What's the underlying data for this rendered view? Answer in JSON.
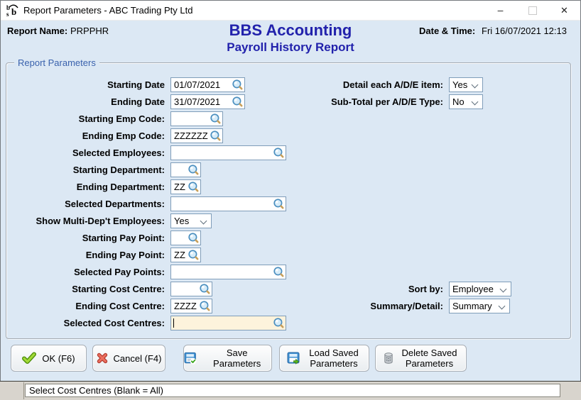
{
  "titlebar": {
    "title": "Report Parameters - ABC Trading Pty Ltd",
    "minimize_glyph": "–",
    "close_glyph": "✕"
  },
  "header": {
    "report_name_label": "Report Name:",
    "report_name_value": "PRPPHR",
    "app_title": "BBS Accounting",
    "report_title": "Payroll History Report",
    "datetime_label": "Date & Time:",
    "datetime_value": "Fri 16/07/2021 12:13"
  },
  "parameters": {
    "legend": "Report Parameters",
    "left_rows": [
      {
        "label": "Starting Date",
        "value": "01/07/2021"
      },
      {
        "label": "Ending Date",
        "value": "31/07/2021"
      },
      {
        "label": "Starting Emp Code:",
        "value": ""
      },
      {
        "label": "Ending Emp Code:",
        "value": "ZZZZZZ"
      },
      {
        "label": "Selected Employees:",
        "value": ""
      },
      {
        "label": "Starting Department:",
        "value": ""
      },
      {
        "label": "Ending Department:",
        "value": "ZZ"
      },
      {
        "label": "Selected Departments:",
        "value": ""
      },
      {
        "label": "Show Multi-Dep't Employees:",
        "value": "Yes"
      },
      {
        "label": "Starting Pay Point:",
        "value": ""
      },
      {
        "label": "Ending Pay Point:",
        "value": "ZZ"
      },
      {
        "label": "Selected Pay Points:",
        "value": ""
      },
      {
        "label": "Starting Cost Centre:",
        "value": ""
      },
      {
        "label": "Ending Cost Centre:",
        "value": "ZZZZ"
      },
      {
        "label": "Selected Cost Centres:",
        "value": ""
      }
    ],
    "right_rows": [
      {
        "label": "Detail each A/D/E item:",
        "value": "Yes"
      },
      {
        "label": "Sub-Total per A/D/E Type:",
        "value": "No"
      },
      {
        "label": "Sort by:",
        "value": "Employee"
      },
      {
        "label": "Summary/Detail:",
        "value": "Summary"
      }
    ]
  },
  "actions": {
    "ok": "OK (F6)",
    "cancel": "Cancel (F4)",
    "save": "Save Parameters",
    "load": "Load Saved Parameters",
    "delete": "Delete Saved Parameters"
  },
  "status": {
    "text": "Select Cost Centres (Blank = All)"
  },
  "icons": {
    "app": "bbs-logo-icon",
    "lookup": "magnifier-lookup-icon",
    "ok": "green-check-icon",
    "cancel": "red-x-icon",
    "save": "save-disk-check-icon",
    "load": "load-disk-arrow-icon",
    "delete": "trash-bin-icon",
    "dropdown": "chevron-down-icon"
  },
  "colors": {
    "content_bg": "#dce8f4",
    "title_blue": "#2222ac",
    "legend_blue": "#3a62ad",
    "field_border": "#7f9db9",
    "focus_bg": "#fdf3dc"
  }
}
